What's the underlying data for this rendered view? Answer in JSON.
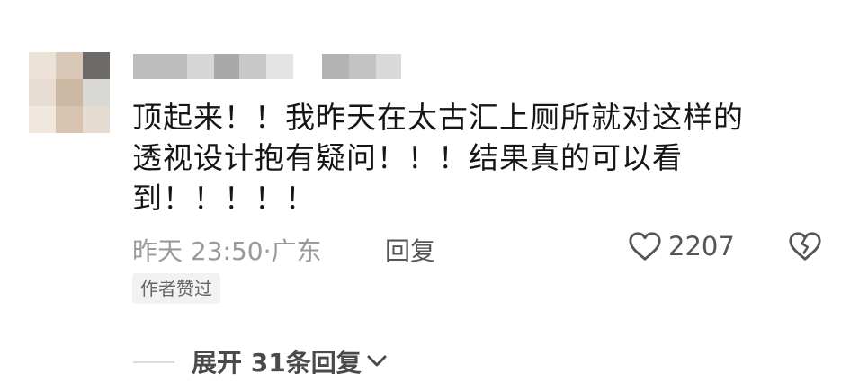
{
  "comment": {
    "text_lines": [
      "顶起来！！我昨天在太古汇上厕所就对这样的",
      "透视设计抱有疑问！！！结果真的可以看",
      "到！！！！！"
    ],
    "timestamp": "昨天 23:50",
    "location_separator": "·",
    "location": "广东",
    "reply_label": "回复",
    "like_count": "2207",
    "author_badge": "作者赞过"
  },
  "replies": {
    "expand_label": "展开 31条回复"
  },
  "icons": {
    "like": "heart-outline-icon",
    "dislike": "broken-heart-icon",
    "expand": "chevron-down-icon"
  },
  "colors": {
    "text": "#161616",
    "meta": "#9a9a9a",
    "action": "#555555",
    "badge_bg": "#f2f2f2"
  }
}
